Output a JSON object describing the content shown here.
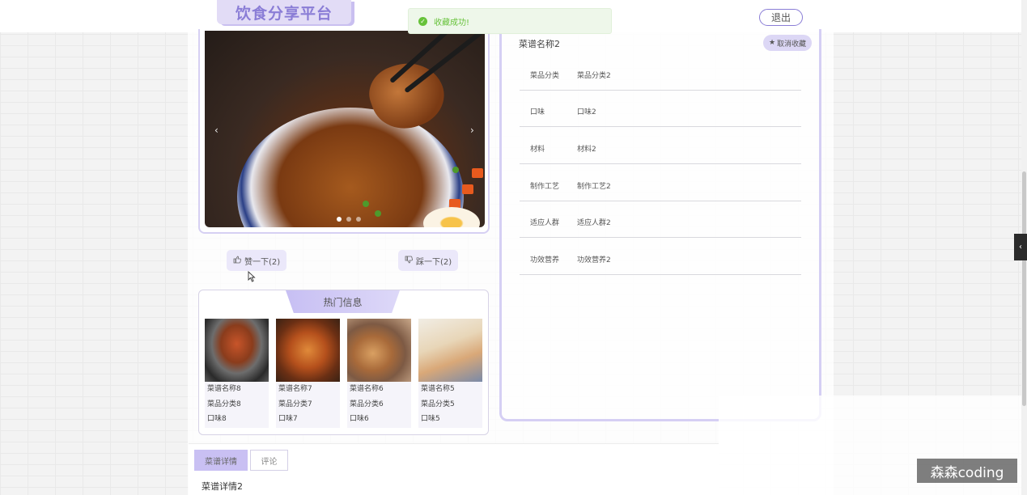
{
  "header": {
    "logo_text": "饮食分享平台",
    "logout_label": "退出"
  },
  "toast": {
    "message": "收藏成功!"
  },
  "carousel": {
    "prev_glyph": "‹",
    "next_glyph": "›",
    "slide_count": 3,
    "active_index": 0
  },
  "votes": {
    "like_label": "赞一下(2)",
    "dislike_label": "踩一下(2)"
  },
  "hot": {
    "title": "热门信息",
    "items": [
      {
        "name": "菜谱名称8",
        "category": "菜品分类8",
        "taste": "口味8"
      },
      {
        "name": "菜谱名称7",
        "category": "菜品分类7",
        "taste": "口味7"
      },
      {
        "name": "菜谱名称6",
        "category": "菜品分类6",
        "taste": "口味6"
      },
      {
        "name": "菜谱名称5",
        "category": "菜品分类5",
        "taste": "口味5"
      }
    ]
  },
  "detail": {
    "recipe_name": "菜谱名称2",
    "unfavorite_label": "取消收藏",
    "rows": [
      {
        "label": "菜品分类",
        "value": "菜品分类2"
      },
      {
        "label": "口味",
        "value": "口味2"
      },
      {
        "label": "材料",
        "value": "材料2"
      },
      {
        "label": "制作工艺",
        "value": "制作工艺2"
      },
      {
        "label": "适应人群",
        "value": "适应人群2"
      },
      {
        "label": "功效营养",
        "value": "功效营养2"
      }
    ]
  },
  "tabs": {
    "details_label": "菜谱详情",
    "comments_label": "评论",
    "content_text": "菜谱详情2"
  },
  "watermark": "森森coding",
  "colors": {
    "accent": "#8a7dd6",
    "accent_light": "#dcd7f5",
    "success": "#67c23a"
  }
}
